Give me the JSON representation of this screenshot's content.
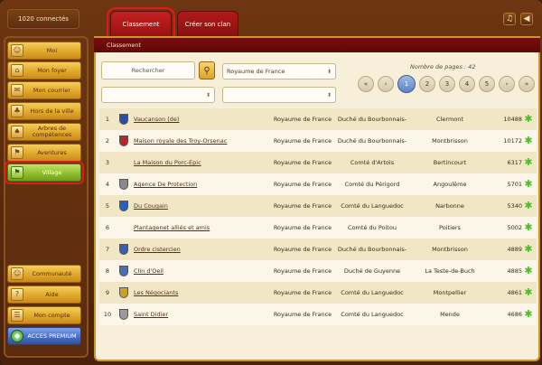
{
  "connected": "1020 connectés",
  "sidebar": {
    "items": [
      {
        "label": "Moi",
        "icon": "person-icon",
        "glyph": "☺"
      },
      {
        "label": "Mon foyer",
        "icon": "house-icon",
        "glyph": "⌂"
      },
      {
        "label": "Mon courrier",
        "icon": "mail-icon",
        "glyph": "✉"
      },
      {
        "label": "Hors de la ville",
        "icon": "field-icon",
        "glyph": "♣"
      },
      {
        "label": "Arbres de compétences",
        "icon": "tree-icon",
        "glyph": "♠"
      },
      {
        "label": "Aventures",
        "icon": "adventure-icon",
        "glyph": "⚑"
      },
      {
        "label": "Village",
        "icon": "flag-icon",
        "glyph": "⚑"
      }
    ],
    "bottom": [
      {
        "label": "Communauté",
        "icon": "community-icon",
        "glyph": "☺"
      },
      {
        "label": "Aide",
        "icon": "help-icon",
        "glyph": "?"
      },
      {
        "label": "Mon compte",
        "icon": "account-icon",
        "glyph": "☰"
      },
      {
        "label": "ACCES PREMIUM",
        "icon": "gem-icon",
        "glyph": "◆"
      }
    ]
  },
  "tabs": [
    {
      "label": "Classement"
    },
    {
      "label": "Créer son clan"
    }
  ],
  "topbar": {
    "music_icon": "♫",
    "sound_icon": "◀"
  },
  "main": {
    "header": "Classement",
    "search_placeholder": "Rechercher",
    "kingdom_select": "Royaume de France",
    "pages_label": "Nombre de pages : 42",
    "pager": [
      "«",
      "‹",
      "1",
      "2",
      "3",
      "4",
      "5",
      "›",
      "»"
    ],
    "current_page": "1"
  },
  "rows": [
    {
      "rank": "1",
      "name": "Vaucanson (de)",
      "kingdom": "Royaume de France",
      "duchy": "Duché du Bourbonnais-",
      "city": "Clermont",
      "score": "10488",
      "flag": "#2a4ea8"
    },
    {
      "rank": "2",
      "name": "Maison royale des Troy-Orsenac",
      "kingdom": "Royaume de France",
      "duchy": "Duché du Bourbonnais-",
      "city": "Montbrisson",
      "score": "10172",
      "flag": "#b8262a"
    },
    {
      "rank": "3",
      "name": "La Maison du Porc-Epic",
      "kingdom": "Royaume de France",
      "duchy": "Comté d'Artois",
      "city": "Bertincourt",
      "score": "6317",
      "flag": ""
    },
    {
      "rank": "4",
      "name": "Agence De Protection",
      "kingdom": "Royaume de France",
      "duchy": "Comté du Périgord",
      "city": "Angoulême",
      "score": "5701",
      "flag": "#8a8a8a"
    },
    {
      "rank": "5",
      "name": "Du Cougain",
      "kingdom": "Royaume de France",
      "duchy": "Comté du Languedoc",
      "city": "Narbonne",
      "score": "5340",
      "flag": "#2a5fbf"
    },
    {
      "rank": "6",
      "name": "Plantagenet alliés et amis",
      "kingdom": "Royaume de France",
      "duchy": "Comté du Poitou",
      "city": "Poitiers",
      "score": "5002",
      "flag": ""
    },
    {
      "rank": "7",
      "name": "Ordre cistercien",
      "kingdom": "Royaume de France",
      "duchy": "Duché du Bourbonnais-",
      "city": "Montbrisson",
      "score": "4889",
      "flag": "#3a5ea8"
    },
    {
      "rank": "8",
      "name": "Clin d'Oeil",
      "kingdom": "Royaume de France",
      "duchy": "Duché de Guyenne",
      "city": "La Teste-de-Buch",
      "score": "4885",
      "flag": "#4a6fb0"
    },
    {
      "rank": "9",
      "name": "Les Négociants",
      "kingdom": "Royaume de France",
      "duchy": "Comté du Languedoc",
      "city": "Montpellier",
      "score": "4861",
      "flag": "#c9a12e"
    },
    {
      "rank": "10",
      "name": "Saint Didier",
      "kingdom": "Royaume de France",
      "duchy": "Comté du Languedoc",
      "city": "Mende",
      "score": "4686",
      "flag": "#9a9a9a"
    }
  ],
  "row_action_icon": "✱"
}
